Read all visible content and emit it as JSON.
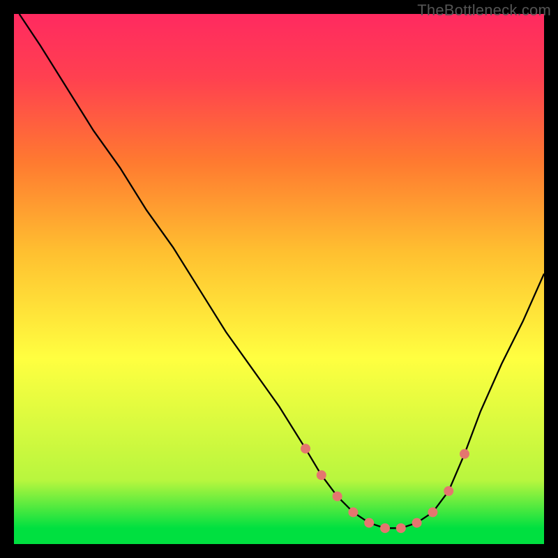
{
  "watermark": "TheBottleneck.com",
  "chart_data": {
    "type": "line",
    "title": "",
    "xlabel": "",
    "ylabel": "",
    "xlim": [
      0,
      100
    ],
    "ylim": [
      0,
      100
    ],
    "grid": false,
    "legend": false,
    "series": [
      {
        "name": "curve",
        "x": [
          1,
          5,
          10,
          15,
          20,
          25,
          30,
          35,
          40,
          45,
          50,
          55,
          58,
          61,
          64,
          67,
          70,
          73,
          76,
          79,
          82,
          85,
          88,
          92,
          96,
          100
        ],
        "y": [
          100,
          94,
          86,
          78,
          71,
          63,
          56,
          48,
          40,
          33,
          26,
          18,
          13,
          9,
          6,
          4,
          3,
          3,
          4,
          6,
          10,
          17,
          25,
          34,
          42,
          51
        ]
      }
    ],
    "markers": {
      "x": [
        55,
        58,
        61,
        64,
        67,
        70,
        73,
        76,
        79,
        82,
        85
      ],
      "y": [
        18,
        13,
        9,
        6,
        4,
        3,
        3,
        4,
        6,
        10,
        17
      ]
    }
  }
}
